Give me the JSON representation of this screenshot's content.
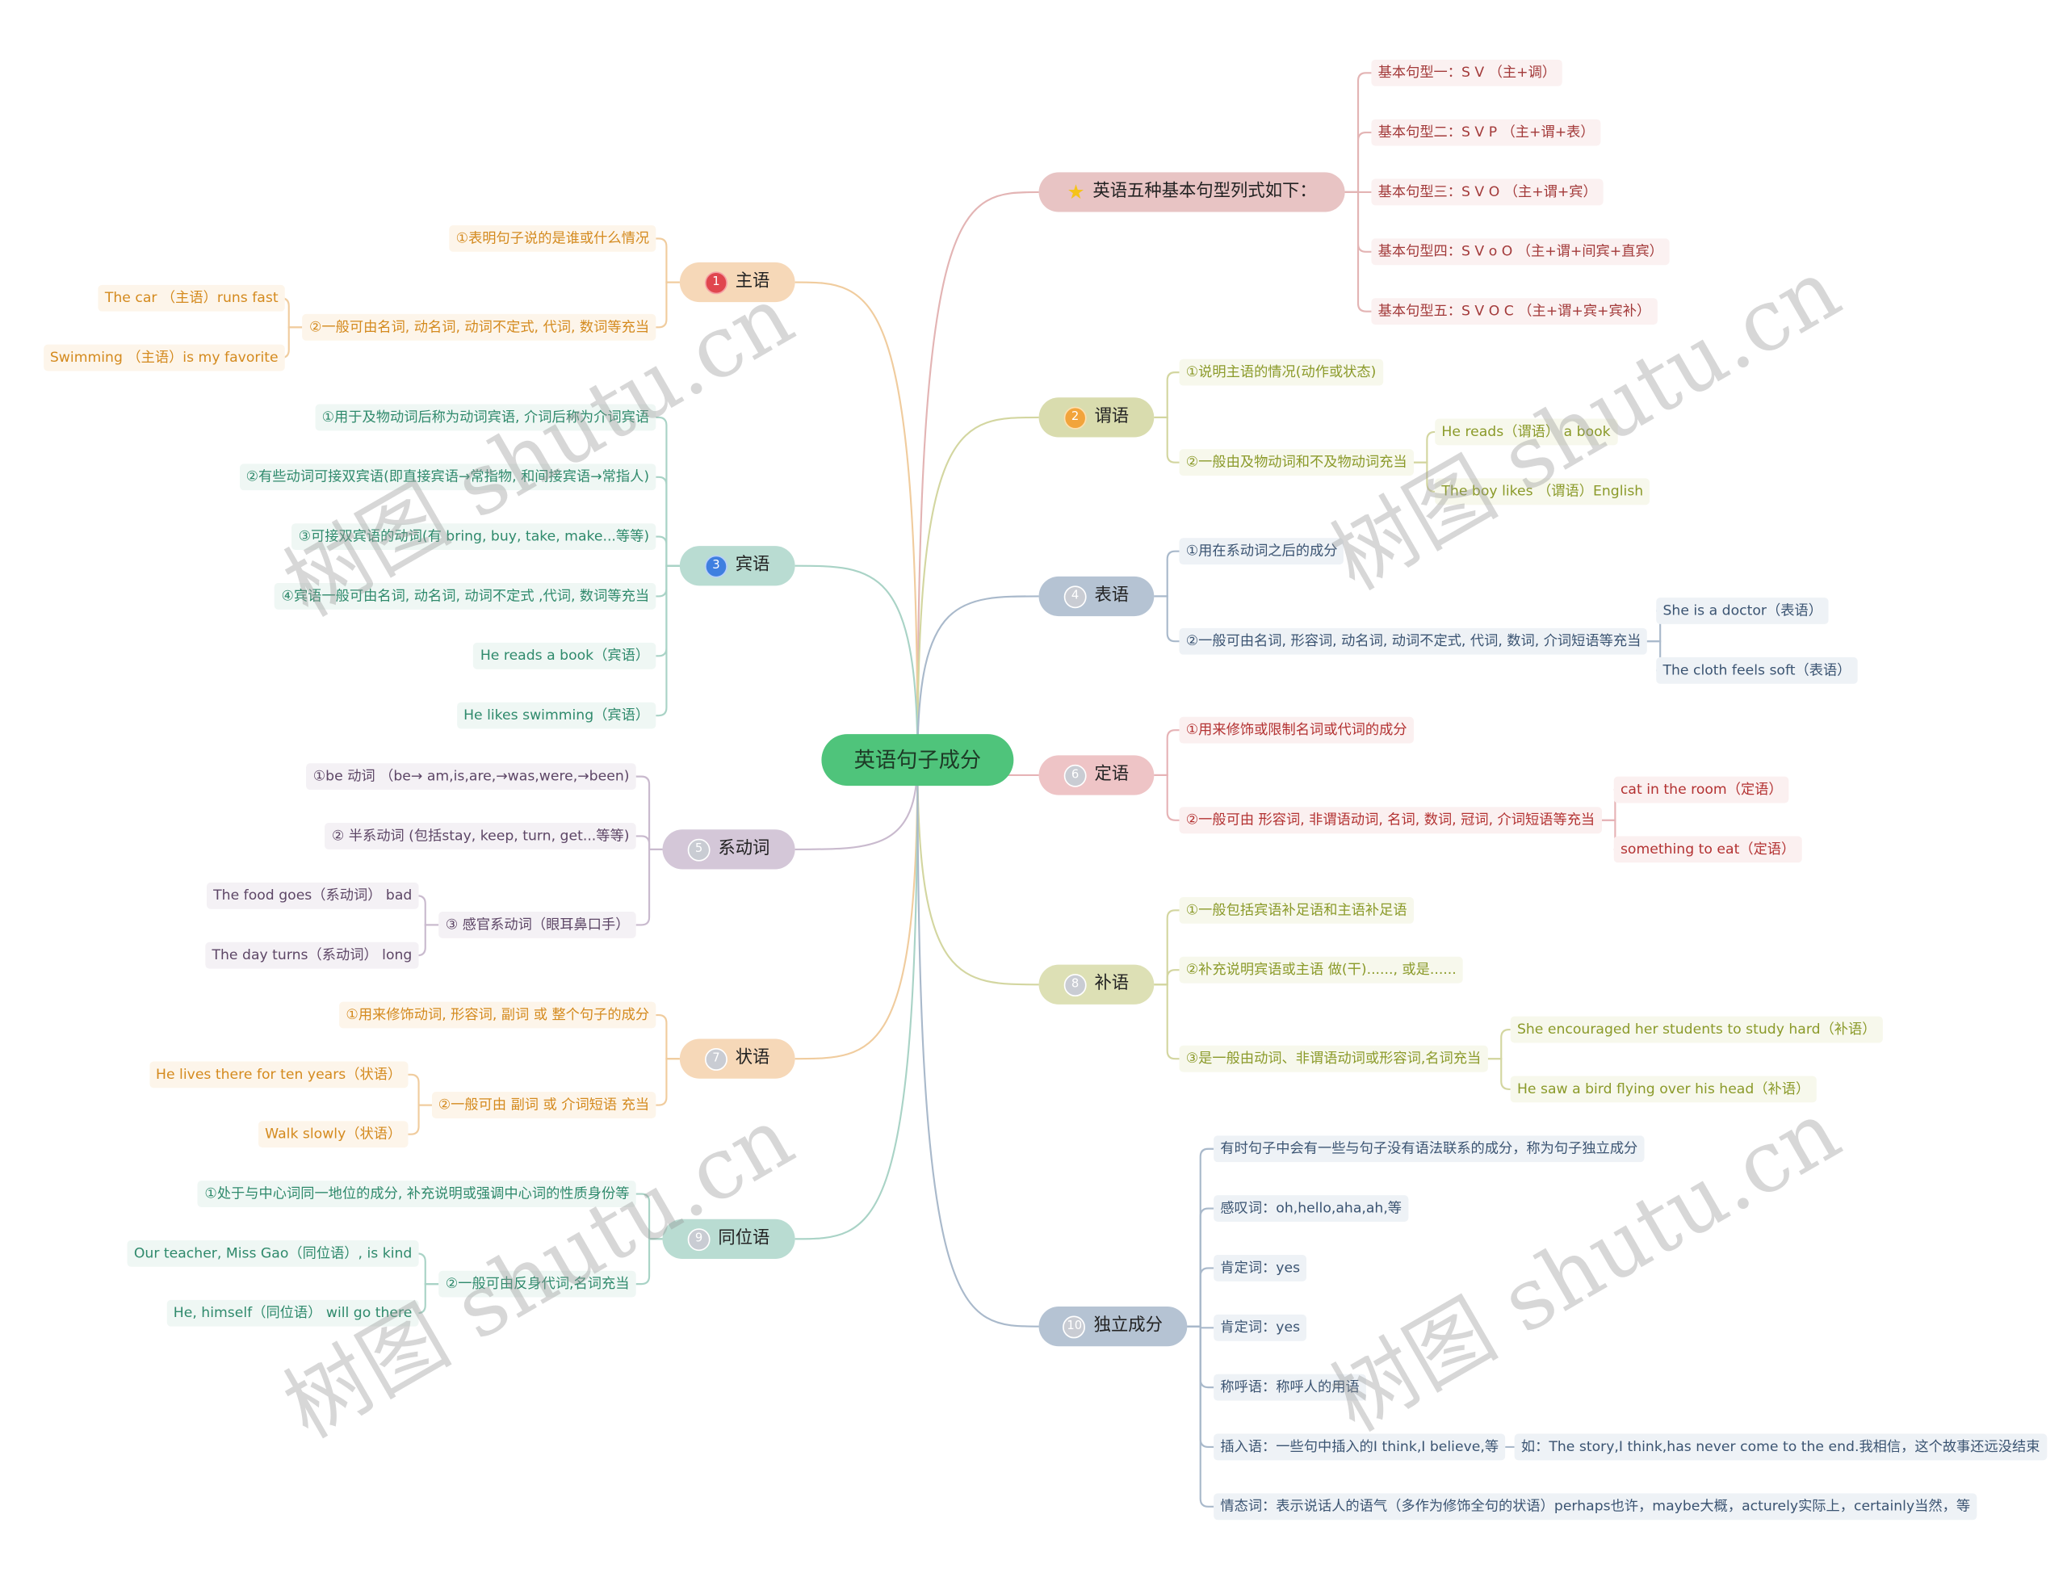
{
  "center": {
    "label": "英语句子成分"
  },
  "colors": {
    "center": "#4fc47b",
    "subject": "#f6d8b8",
    "predicate": "#d9dcae",
    "object": "#b9dcd2",
    "predicative": "#b5c3d3",
    "linking": "#d4c7d8",
    "attributive": "#eec4c6",
    "complement": "#dde0b5",
    "independent": "#b5c3d3",
    "patterns": "#e8c4c4"
  },
  "branches": [
    {
      "icon": "star-icon",
      "label": "英语五种基本句型列式如下：",
      "items": [
        {
          "text": "基本句型一：S  V （主+调）"
        },
        {
          "text": "基本句型二：S  V  P （主+谓+表）"
        },
        {
          "text": "基本句型三：S  V  O （主+谓+宾）"
        },
        {
          "text": "基本句型四：S  V  o  O （主+谓+间宾+直宾）"
        },
        {
          "text": "基本句型五：S  V  O  C （主+谓+宾+宾补）"
        }
      ]
    },
    {
      "number": "1",
      "label": "主语",
      "items": [
        {
          "text": "①表明句子说的是谁或什么情况"
        },
        {
          "text": "②一般可由名词, 动名词, 动词不定式, 代词, 数词等充当",
          "children": [
            "The car （主语）runs fast",
            "Swimming （主语）is my favorite"
          ]
        }
      ]
    },
    {
      "number": "2",
      "label": "谓语",
      "items": [
        {
          "text": "①说明主语的情况(动作或状态)"
        },
        {
          "text": "②一般由及物动词和不及物动词充当",
          "children": [
            "He reads（谓语） a book",
            "The boy likes （谓语）English"
          ]
        }
      ]
    },
    {
      "number": "3",
      "label": "宾语",
      "items": [
        {
          "text": "①用于及物动词后称为动词宾语, 介词后称为介词宾语"
        },
        {
          "text": "②有些动词可接双宾语(即直接宾语→常指物, 和间接宾语→常指人)"
        },
        {
          "text": "③可接双宾语的动词(有 bring, buy, take, make...等等)"
        },
        {
          "text": "④宾语一般可由名词, 动名词, 动词不定式 ,代词, 数词等充当"
        },
        {
          "text": "He reads a book（宾语）"
        },
        {
          "text": "He likes swimming（宾语）"
        }
      ]
    },
    {
      "number": "4",
      "label": "表语",
      "items": [
        {
          "text": "①用在系动词之后的成分"
        },
        {
          "text": "②一般可由名词, 形容词, 动名词, 动词不定式, 代词, 数词, 介词短语等充当",
          "children": [
            "She is a doctor（表语）",
            "The cloth feels soft（表语）"
          ]
        }
      ]
    },
    {
      "number": "5",
      "label": "系动词",
      "items": [
        {
          "text": "①be 动词 （be→ am,is,are,→was,were,→been)"
        },
        {
          "text": "② 半系动词 (包括stay, keep, turn, get...等等)"
        },
        {
          "text": "③ 感官系动词（眼耳鼻口手）",
          "children": [
            "The food goes（系动词） bad",
            "The day turns（系动词） long"
          ]
        }
      ]
    },
    {
      "number": "6",
      "label": "定语",
      "items": [
        {
          "text": "①用来修饰或限制名词或代词的成分"
        },
        {
          "text": "②一般可由 形容词, 非谓语动词, 名词, 数词, 冠词, 介词短语等充当",
          "children": [
            "cat in the room（定语）",
            "something to eat（定语）"
          ]
        }
      ]
    },
    {
      "number": "7",
      "label": "状语",
      "items": [
        {
          "text": "①用来修饰动词, 形容词, 副词 或 整个句子的成分"
        },
        {
          "text": "②一般可由 副词 或 介词短语 充当",
          "children": [
            "He lives there for ten years（状语）",
            "Walk slowly（状语）"
          ]
        }
      ]
    },
    {
      "number": "8",
      "label": "补语",
      "items": [
        {
          "text": "①一般包括宾语补足语和主语补足语"
        },
        {
          "text": "②补充说明宾语或主语  做(干)......, 或是......"
        },
        {
          "text": "③是一般由动词、非谓语动词或形容词,名词充当",
          "children": [
            "She encouraged her students to study hard（补语）",
            "He saw a bird flying over his head（补语）"
          ]
        }
      ]
    },
    {
      "number": "9",
      "label": "同位语",
      "items": [
        {
          "text": "①处于与中心词同一地位的成分, 补充说明或强调中心词的性质身份等"
        },
        {
          "text": "②一般可由反身代词,名词充当",
          "children": [
            "Our teacher, Miss Gao（同位语）, is kind",
            "He, himself（同位语） will go there"
          ]
        }
      ]
    },
    {
      "number": "10",
      "label": "独立成分",
      "items": [
        {
          "text": "有时句子中会有一些与句子没有语法联系的成分，称为句子独立成分"
        },
        {
          "text": "感叹词：oh,hello,aha,ah,等"
        },
        {
          "text": "肯定词：yes"
        },
        {
          "text": "肯定词：yes"
        },
        {
          "text": "称呼语：称呼人的用语"
        },
        {
          "text": "插入语：一些句中插入的I think,I believe,等",
          "children": [
            "如：The story,I think,has never come to the end.我相信，这个故事还远没结束"
          ]
        },
        {
          "text": "情态词：表示说话人的语气（多作为修饰全句的状语）perhaps也许，maybe大概，acturely实际上，certainly当然，等"
        }
      ]
    }
  ],
  "watermark": "树图 shutu.cn"
}
